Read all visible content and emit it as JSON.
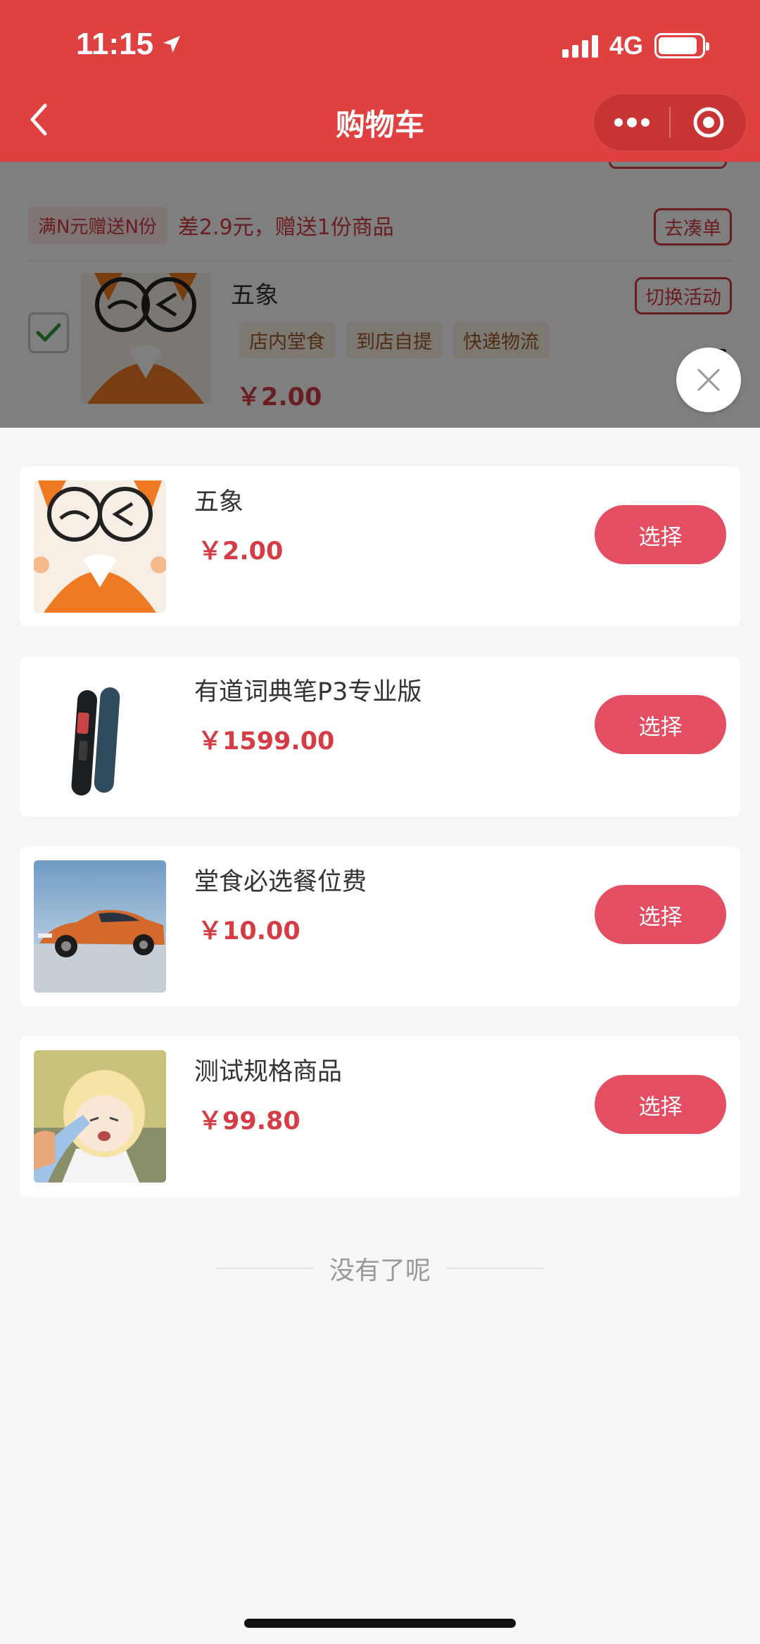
{
  "status_bar": {
    "time": "11:15",
    "network": "4G",
    "battery_level": 0.9
  },
  "nav": {
    "title": "购物车"
  },
  "background_cart": {
    "promo_tag": "满N元赠送N份",
    "promo_text": "差2.9元，赠送1份商品",
    "promo_button": "去凑单",
    "item": {
      "name": "五象",
      "switch_button": "切换活动",
      "tags": [
        "店内堂食",
        "到店自提",
        "快递物流"
      ],
      "price": "￥2.00",
      "checked": true
    }
  },
  "sheet": {
    "products": [
      {
        "name": "五象",
        "price": "￥2.00",
        "button": "选择",
        "thumb": "fox-cartoon-icon"
      },
      {
        "name": "有道词典笔P3专业版",
        "price": "￥1599.00",
        "button": "选择",
        "thumb": "dictionary-pen-image"
      },
      {
        "name": "堂食必选餐位费",
        "price": "￥10.00",
        "button": "选择",
        "thumb": "orange-car-image"
      },
      {
        "name": "测试规格商品",
        "price": "￥99.80",
        "button": "选择",
        "thumb": "anime-girl-image"
      }
    ],
    "end_text": "没有了呢"
  },
  "colors": {
    "header": "#df4040",
    "accent": "#e34e62",
    "price": "#d63c45"
  }
}
